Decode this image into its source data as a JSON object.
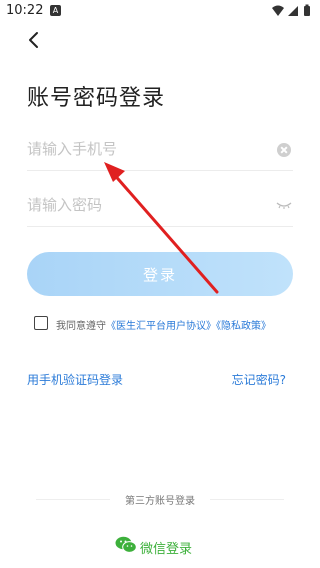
{
  "status_bar": {
    "time": "10:22",
    "badge": "A"
  },
  "title": "账号密码登录",
  "phone_field": {
    "placeholder": "请输入手机号",
    "value": ""
  },
  "password_field": {
    "placeholder": "请输入密码",
    "value": ""
  },
  "login_button": "登录",
  "agreement": {
    "prefix": "我同意遵守",
    "user_agreement": "《医生汇平台用户协议》",
    "privacy_policy": "《隐私政策》"
  },
  "sms_login_link": "用手机验证码登录",
  "forgot_password_link": "忘记密码?",
  "third_party": {
    "heading": "第三方账号登录",
    "wechat_label": "微信登录"
  },
  "colors": {
    "accent": "#2b7bd8",
    "button": "#b3daf9",
    "wechat": "#3db03b",
    "annotation_arrow": "#e02020"
  }
}
